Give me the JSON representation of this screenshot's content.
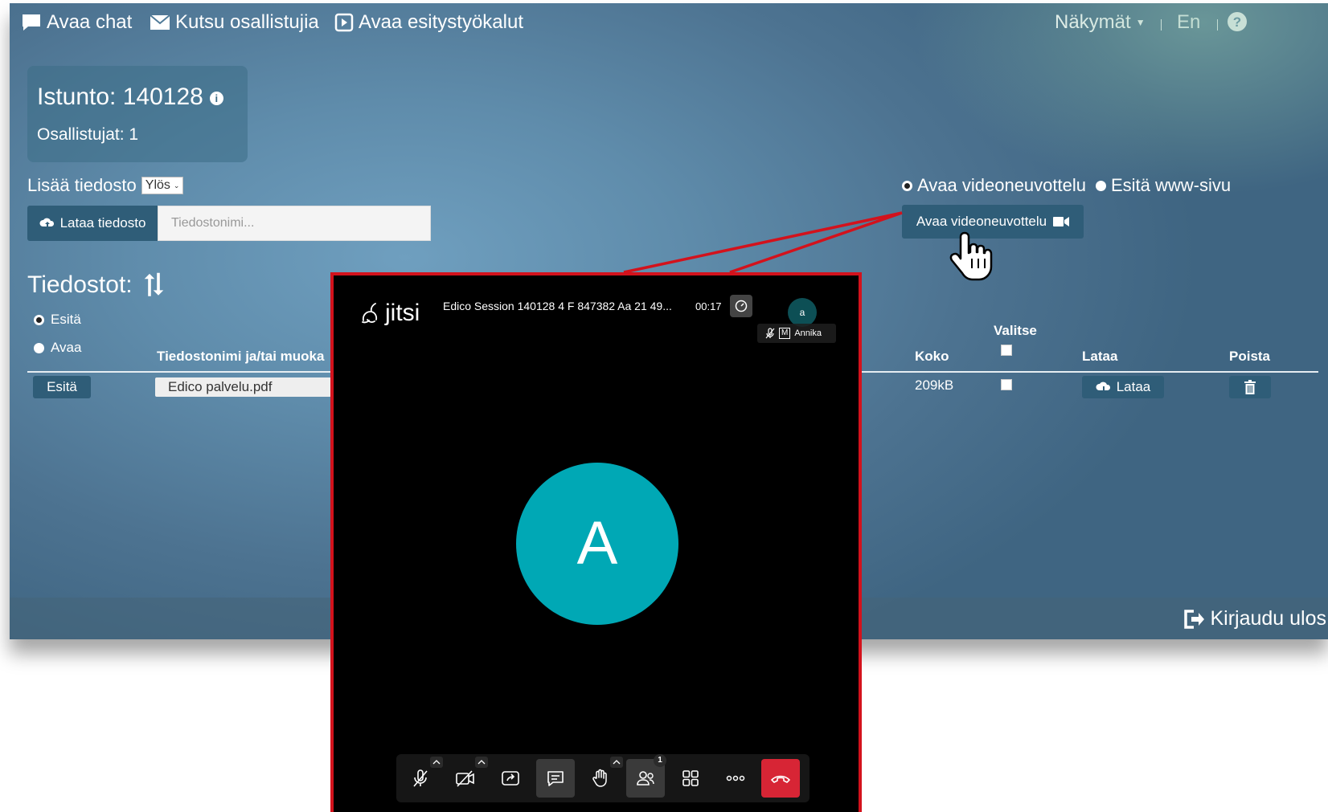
{
  "topbar": {
    "open_chat": "Avaa chat",
    "invite": "Kutsu osallistujia",
    "presentation_tools": "Avaa esitystyökalut",
    "views": "Näkymät",
    "language": "En"
  },
  "session": {
    "title": "Istunto: 140128",
    "participants": "Osallistujat: 1"
  },
  "add_file": {
    "label": "Lisää tiedosto",
    "direction": "Ylös",
    "upload_button": "Lataa tiedosto",
    "filename_placeholder": "Tiedostonimi..."
  },
  "mode": {
    "option_video": "Avaa videoneuvottelu",
    "option_web": "Esitä www-sivu",
    "selected": "Avaa videoneuvottelu",
    "open_video_button": "Avaa videoneuvottelu"
  },
  "files": {
    "title": "Tiedostot:",
    "radio_present": "Esitä",
    "radio_open": "Avaa",
    "columns": {
      "filename": "Tiedostonimi ja/tai muoka",
      "size": "Koko",
      "select": "Valitse",
      "download": "Lataa",
      "delete": "Poista"
    },
    "rows": [
      {
        "action": "Esitä",
        "filename": "Edico palvelu.pdf",
        "size": "209kB",
        "download": "Lataa"
      }
    ]
  },
  "footer": {
    "logout": "Kirjaudu ulos"
  },
  "jitsi": {
    "logo": "jitsi",
    "meeting_title": "Edico Session 140128 4 F 847382 Aa 21 49...",
    "timer": "00:17",
    "thumb_initial": "a",
    "moderator_badge": "M",
    "participant_name": "Annika",
    "big_avatar_initial": "A",
    "participant_count": "1"
  },
  "colors": {
    "button": "#2f5d78",
    "callout_red": "#d3121c",
    "avatar": "#00a8b5",
    "hangup": "#d72535"
  }
}
